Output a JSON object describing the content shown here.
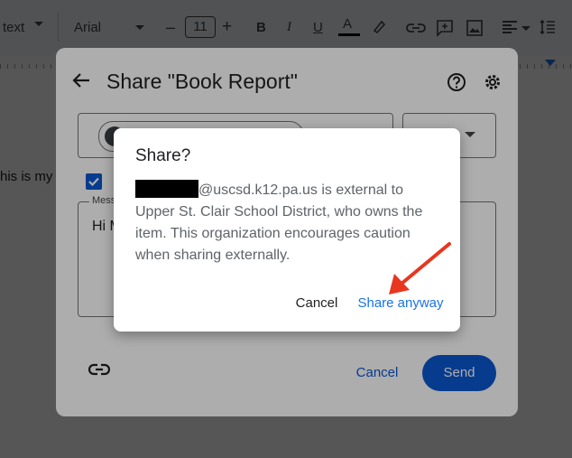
{
  "toolbar": {
    "style_label": "text",
    "font_label": "Arial",
    "font_size": "11",
    "minus": "–",
    "plus": "+",
    "bold": "B",
    "italic": "I",
    "underline": "U",
    "text_color": "A"
  },
  "document": {
    "visible_text": "his is my b"
  },
  "share_dialog": {
    "title": "Share \"Book Report\"",
    "message_label": "Mess",
    "message_text": "Hi M",
    "cancel_label": "Cancel",
    "send_label": "Send"
  },
  "confirm_dialog": {
    "title": "Share?",
    "body_suffix": "@uscsd.k12.pa.us is external to Upper St. Clair School District, who owns the item. This organization encourages caution when sharing externally.",
    "cancel_label": "Cancel",
    "share_label": "Share anyway"
  },
  "colors": {
    "accent": "#1a73e8",
    "send_button": "#0b57d0",
    "annotation": "#e8361f"
  },
  "icons": [
    "back-arrow-icon",
    "help-icon",
    "gear-icon",
    "link-icon",
    "checkbox-checked-icon"
  ]
}
